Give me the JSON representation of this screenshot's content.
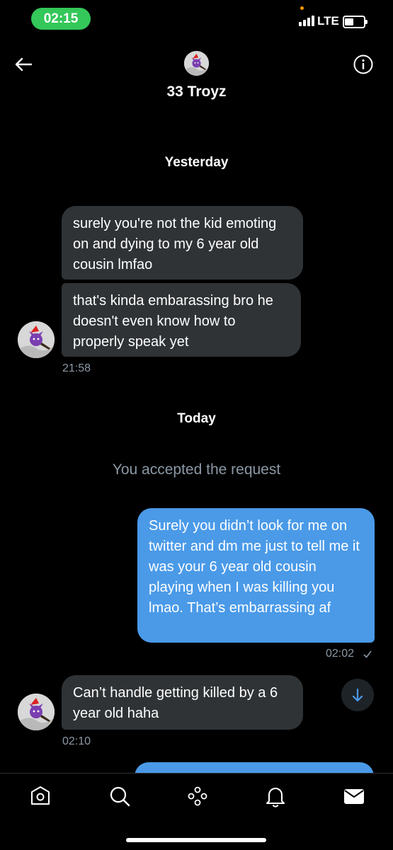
{
  "status": {
    "time": "02:15",
    "network": "LTE"
  },
  "header": {
    "title": "33 Troyz"
  },
  "days": {
    "yesterday": "Yesterday",
    "today": "Today"
  },
  "messages": {
    "in1": "surely you're not the kid emoting on and dying to my 6 year old cousin lmfao",
    "in2": "that's kinda embarassing bro he doesn't even know how to properly speak yet",
    "in2_time": "21:58",
    "system": "You accepted the request",
    "out1": "Surely you didn’t look for me on twitter and dm me just to tell me it was your 6 year old cousin playing when I was killing you lmao. That’s embarrassing af",
    "out1_time": "02:02",
    "in3": "Can’t handle getting killed by a 6 year old haha",
    "in3_time": "02:10"
  },
  "colors": {
    "incoming": "#2f3336",
    "outgoing": "#4a9ae8",
    "status_time_bg": "#34c759",
    "muted": "#8b98a5"
  },
  "icons": {
    "header": [
      "back-arrow-icon",
      "info-icon"
    ],
    "nav": [
      "home-icon",
      "search-icon",
      "spaces-icon",
      "notifications-icon",
      "messages-icon"
    ],
    "scroll": "arrow-down-icon",
    "read": "check-icon"
  }
}
